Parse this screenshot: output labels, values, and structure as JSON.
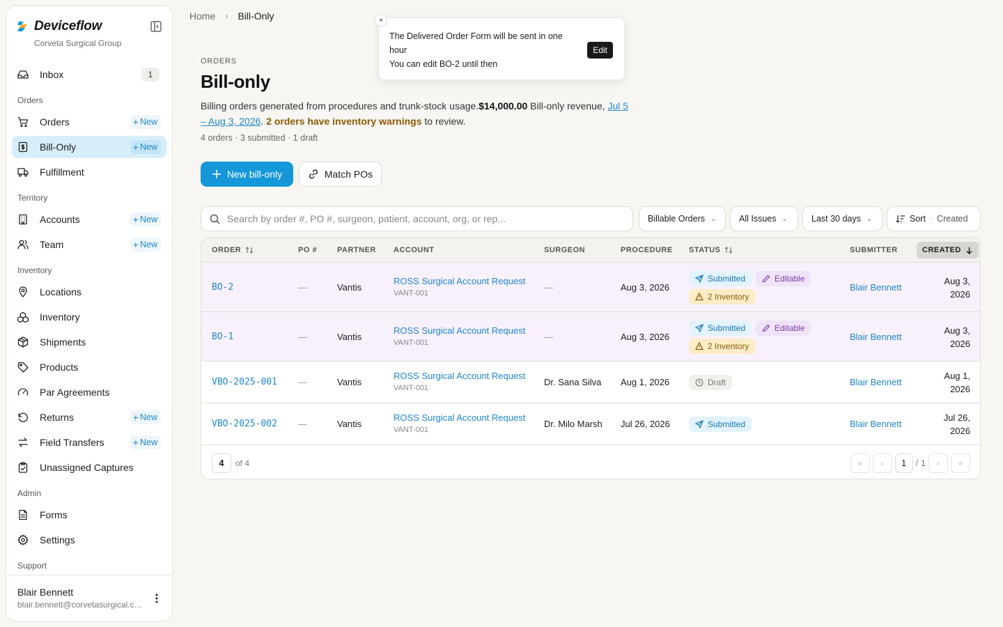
{
  "brand": {
    "name": "Deviceflow",
    "org": "Corveta Surgical Group"
  },
  "sidebar": {
    "items": [
      {
        "type": "item",
        "label": "Inbox",
        "icon": "inbox-icon",
        "badge": "1"
      },
      {
        "type": "section",
        "label": "Orders"
      },
      {
        "type": "item",
        "label": "Orders",
        "icon": "cart-icon",
        "new": "New"
      },
      {
        "type": "item",
        "label": "Bill-Only",
        "icon": "invoice-icon",
        "new": "New",
        "active": true
      },
      {
        "type": "item",
        "label": "Fulfillment",
        "icon": "truck-icon"
      },
      {
        "type": "section",
        "label": "Territory"
      },
      {
        "type": "item",
        "label": "Accounts",
        "icon": "building-icon",
        "new": "New"
      },
      {
        "type": "item",
        "label": "Team",
        "icon": "users-icon",
        "new": "New"
      },
      {
        "type": "section",
        "label": "Inventory"
      },
      {
        "type": "item",
        "label": "Locations",
        "icon": "map-pin-icon"
      },
      {
        "type": "item",
        "label": "Inventory",
        "icon": "boxes-icon"
      },
      {
        "type": "item",
        "label": "Shipments",
        "icon": "package-icon"
      },
      {
        "type": "item",
        "label": "Products",
        "icon": "tag-icon"
      },
      {
        "type": "item",
        "label": "Par Agreements",
        "icon": "gauge-icon"
      },
      {
        "type": "item",
        "label": "Returns",
        "icon": "rotate-ccw-icon",
        "new": "New"
      },
      {
        "type": "item",
        "label": "Field Transfers",
        "icon": "transfer-icon",
        "new": "New"
      },
      {
        "type": "item",
        "label": "Unassigned Captures",
        "icon": "clipboard-check-icon"
      },
      {
        "type": "section",
        "label": "Admin"
      },
      {
        "type": "item",
        "label": "Forms",
        "icon": "file-icon"
      },
      {
        "type": "item",
        "label": "Settings",
        "icon": "gear-icon"
      },
      {
        "type": "section",
        "label": "Support"
      }
    ],
    "user": {
      "name": "Blair Bennett",
      "email": "blair.bennett@corvetasurgical.com"
    }
  },
  "breadcrumb": {
    "home": "Home",
    "current": "Bill-Only"
  },
  "toast": {
    "line1": "The Delivered Order Form will be sent in one hour",
    "line2": "You can edit BO-2 until then",
    "edit_label": "Edit",
    "close_label": "×"
  },
  "header": {
    "eyebrow": "ORDERS",
    "title": "Bill-only",
    "desc_prefix": "Billing orders generated from procedures and trunk-stock usage.",
    "revenue": "$14,000.00",
    "revenue_suffix": " Bill-only revenue,",
    "date_range": "Jul 5 – Aug 3, 2026",
    "date_suffix": ". ",
    "warnings": "2 orders have inventory warnings",
    "warnings_suffix": " to review.",
    "counts": "4 orders · 3 submitted · 1 draft"
  },
  "actions": {
    "new_label": "New bill-only",
    "match_label": "Match POs"
  },
  "filters": {
    "search_placeholder": "Search by order #, PO #, surgeon, patient, account, org, or rep...",
    "type": "Billable Orders",
    "issues": "All Issues",
    "range": "Last 30 days",
    "sort_label": "Sort",
    "sort_sep": "·",
    "sort_value": "Created"
  },
  "table": {
    "columns": {
      "order": "ORDER",
      "po": "PO #",
      "partner": "PARTNER",
      "account": "ACCOUNT",
      "surgeon": "SURGEON",
      "procedure": "PROCEDURE",
      "status": "STATUS",
      "submitter": "SUBMITTER",
      "created": "CREATED"
    },
    "rows": [
      {
        "order": "BO-2",
        "po": "—",
        "partner": "Vantis",
        "account": "ROSS Surgical Account Request",
        "account_id": "VANT-001",
        "surgeon": "—",
        "procedure": "Aug 3, 2026",
        "status": "Submitted",
        "editable": "Editable",
        "inventory": "2 Inventory",
        "submitter": "Blair Bennett",
        "created_1": "Aug 3,",
        "created_2": "2026"
      },
      {
        "order": "BO-1",
        "po": "—",
        "partner": "Vantis",
        "account": "ROSS Surgical Account Request",
        "account_id": "VANT-001",
        "surgeon": "—",
        "procedure": "Aug 3, 2026",
        "status": "Submitted",
        "editable": "Editable",
        "inventory": "2 Inventory",
        "submitter": "Blair Bennett",
        "created_1": "Aug 3,",
        "created_2": "2026"
      },
      {
        "order": "VBO-2025-001",
        "po": "—",
        "partner": "Vantis",
        "account": "ROSS Surgical Account Request",
        "account_id": "VANT-001",
        "surgeon": "Dr. Sana Silva",
        "procedure": "Aug 1, 2026",
        "status": "Draft",
        "submitter": "Blair Bennett",
        "created_1": "Aug 1,",
        "created_2": "2026"
      },
      {
        "order": "VBO-2025-002",
        "po": "—",
        "partner": "Vantis",
        "account": "ROSS Surgical Account Request",
        "account_id": "VANT-001",
        "surgeon": "Dr. Milo Marsh",
        "procedure": "Jul 26, 2026",
        "status": "Submitted",
        "submitter": "Blair Bennett",
        "created_1": "Jul 26,",
        "created_2": "2026"
      }
    ],
    "page_size": "4",
    "of_total": "of 4",
    "page_current": "1",
    "page_sep": "/",
    "page_total": "1"
  },
  "colors": {
    "accent": "#1597d9",
    "active_nav": "#d6eef9",
    "link": "#1f86c8",
    "warning": "#8a5a00"
  }
}
